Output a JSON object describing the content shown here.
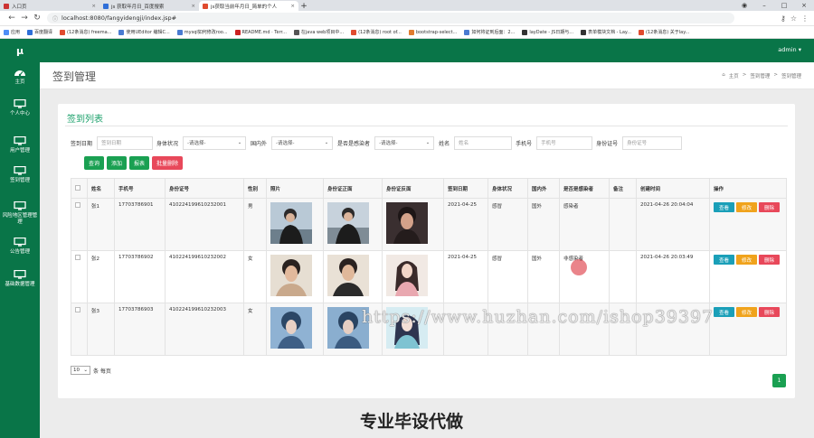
{
  "browser": {
    "tabs": [
      {
        "label": "入口页",
        "color": "#cc3333",
        "active": false
      },
      {
        "label": "js 获取年月日_百度搜索",
        "color": "#2f6fd8",
        "active": false
      },
      {
        "label": "js获取当前年月日_简单的个人",
        "color": "#e04b2f",
        "active": true
      }
    ],
    "url": "localhost:8080/fangyidengji/index.jsp#",
    "bookmarks": [
      {
        "label": "应用",
        "color": "#4f8ef7"
      },
      {
        "label": "百度翻译",
        "color": "#2f6fd8"
      },
      {
        "label": "(12条消息) freema...",
        "color": "#e04b2f"
      },
      {
        "label": "使用UEditor 编辑C...",
        "color": "#4a7bd1"
      },
      {
        "label": "mysql如何修改roo...",
        "color": "#4a7bd1"
      },
      {
        "label": "README.md · Terr...",
        "color": "#cc2222"
      },
      {
        "label": "在java web项目中...",
        "color": "#555555"
      },
      {
        "label": "(12条消息) root of...",
        "color": "#e04b2f"
      },
      {
        "label": "bootstrap-select...",
        "color": "#e07b2f"
      },
      {
        "label": "如何将证到后面：2...",
        "color": "#4a7bd1"
      },
      {
        "label": "layDate - JS日期与...",
        "color": "#333333"
      },
      {
        "label": "表单模块文档 - Lay...",
        "color": "#333333"
      },
      {
        "label": "(12条消息) 关于lay...",
        "color": "#e04b2f"
      }
    ]
  },
  "header": {
    "logo": "μ",
    "user": "admin ▾"
  },
  "sidebar": [
    {
      "label": "主页",
      "icon": "dashboard-icon"
    },
    {
      "label": "个人中心",
      "icon": "monitor-icon"
    },
    {
      "label": "用户管理",
      "icon": "monitor-icon"
    },
    {
      "label": "签到管理",
      "icon": "monitor-icon"
    },
    {
      "label": "风险地区管理管理",
      "icon": "monitor-icon"
    },
    {
      "label": "公告管理",
      "icon": "monitor-icon"
    },
    {
      "label": "基础数据管理",
      "icon": "monitor-icon"
    }
  ],
  "page": {
    "title": "签到管理",
    "breadcrumb": [
      "主页",
      ">",
      "签到管理",
      ">",
      "签到管理"
    ]
  },
  "panel": {
    "title": "签到列表"
  },
  "filters": {
    "date_label": "签到日期",
    "date_placeholder": "签到日期",
    "health_label": "身体状况",
    "health_value": "-请选择-",
    "inout_label": "国内外",
    "inout_value": "-请选择-",
    "infected_label": "是否是感染者",
    "infected_value": "-请选择-",
    "name_label": "姓名",
    "name_placeholder": "姓名",
    "phone_label": "手机号",
    "phone_placeholder": "手机号",
    "id_label": "身份证号",
    "id_placeholder": "身份证号"
  },
  "actions": {
    "search": "查询",
    "add": "添加",
    "report": "报表",
    "batch_delete": "批量删除"
  },
  "table": {
    "headers": [
      "",
      "姓名",
      "手机号",
      "身份证号",
      "性别",
      "照片",
      "身份证正面",
      "身份证反面",
      "签到日期",
      "身体状况",
      "国内外",
      "是否是感染者",
      "备注",
      "创建时间",
      "操作"
    ],
    "rows": [
      {
        "name": "张1",
        "phone": "17703786901",
        "id": "410224199610232001",
        "gender": "男",
        "date": "2021-04-25",
        "health": "感冒",
        "inout": "国外",
        "infected": "感染者",
        "note": "",
        "created": "2021-04-26 20:04:04"
      },
      {
        "name": "张2",
        "phone": "17703786902",
        "id": "410224199610232002",
        "gender": "女",
        "date": "2021-04-25",
        "health": "感冒",
        "inout": "国外",
        "infected": "非感染者",
        "note": "",
        "created": "2021-04-26 20:03:49"
      },
      {
        "name": "张3",
        "phone": "17703786903",
        "id": "410224199610232003",
        "gender": "女",
        "date": "",
        "health": "",
        "inout": "",
        "infected": "",
        "note": "",
        "created": ""
      }
    ],
    "row_buttons": {
      "view": "查看",
      "edit": "修改",
      "delete": "删除"
    }
  },
  "pager": {
    "page_size": "10",
    "per_page_label": "条 每页",
    "current": "1"
  },
  "overlay": {
    "watermark": "https://www.huzhan.com/ishop39397",
    "caption": "专业毕设代做"
  }
}
